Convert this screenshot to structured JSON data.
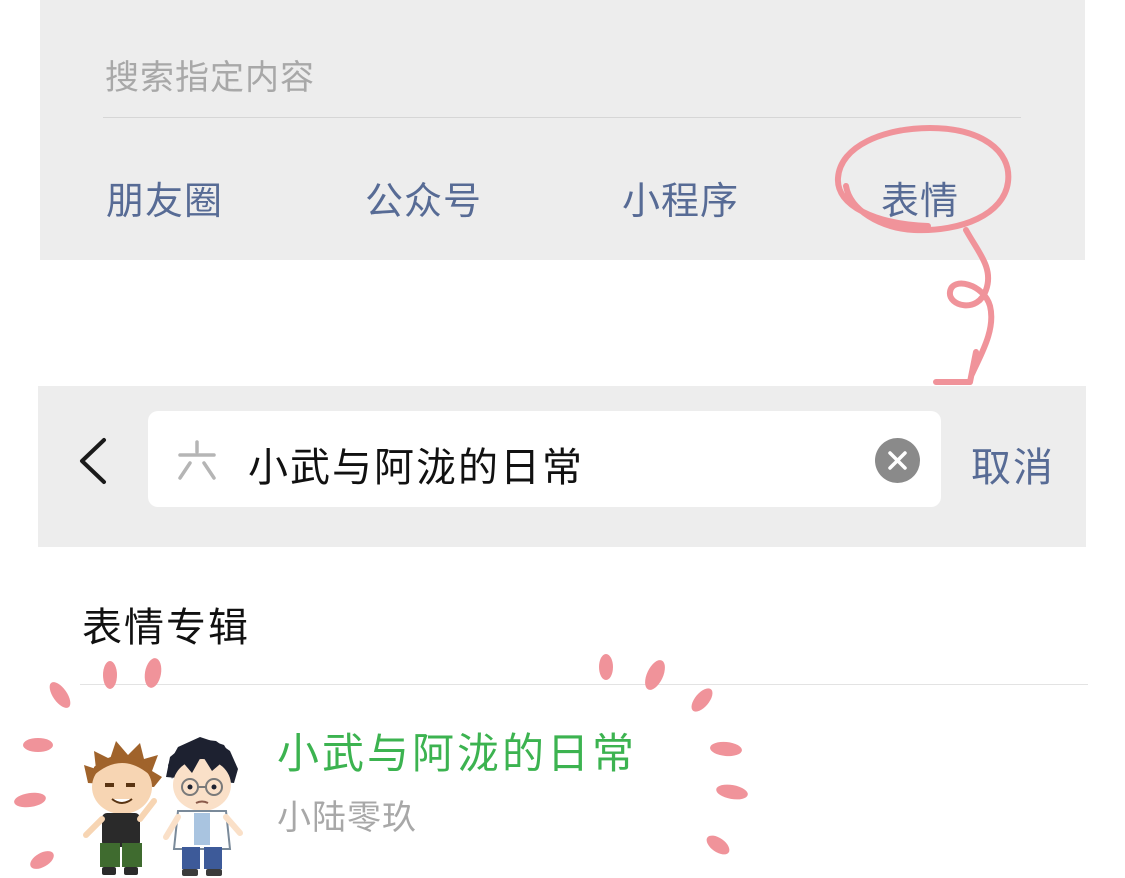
{
  "top_panel": {
    "search_prompt": "搜索指定内容",
    "categories": [
      {
        "label": "朋友圈"
      },
      {
        "label": "公众号"
      },
      {
        "label": "小程序"
      },
      {
        "label": "表情"
      }
    ]
  },
  "search_bar": {
    "back_icon": "chevron-left-icon",
    "search_icon": "sticker-search-icon",
    "query": "小武与阿泷的日常",
    "clear_icon": "clear-icon",
    "cancel_label": "取消"
  },
  "results": {
    "section_title": "表情专辑",
    "items": [
      {
        "title": "小武与阿泷的日常",
        "author": "小陆零玖"
      }
    ]
  },
  "colors": {
    "link_blue": "#576b95",
    "result_green": "#3cb350",
    "panel_gray": "#ededed",
    "annotation_pink": "#f0939a"
  }
}
